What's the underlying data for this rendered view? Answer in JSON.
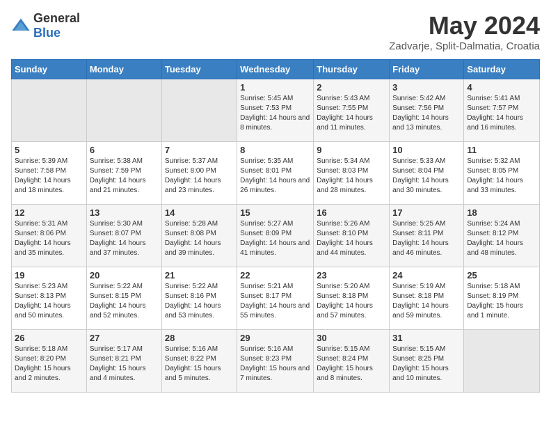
{
  "logo": {
    "text_general": "General",
    "text_blue": "Blue"
  },
  "header": {
    "month": "May 2024",
    "location": "Zadvarje, Split-Dalmatia, Croatia"
  },
  "days_of_week": [
    "Sunday",
    "Monday",
    "Tuesday",
    "Wednesday",
    "Thursday",
    "Friday",
    "Saturday"
  ],
  "weeks": [
    [
      {
        "day": "",
        "info": ""
      },
      {
        "day": "",
        "info": ""
      },
      {
        "day": "",
        "info": ""
      },
      {
        "day": "1",
        "info": "Sunrise: 5:45 AM\nSunset: 7:53 PM\nDaylight: 14 hours and 8 minutes."
      },
      {
        "day": "2",
        "info": "Sunrise: 5:43 AM\nSunset: 7:55 PM\nDaylight: 14 hours and 11 minutes."
      },
      {
        "day": "3",
        "info": "Sunrise: 5:42 AM\nSunset: 7:56 PM\nDaylight: 14 hours and 13 minutes."
      },
      {
        "day": "4",
        "info": "Sunrise: 5:41 AM\nSunset: 7:57 PM\nDaylight: 14 hours and 16 minutes."
      }
    ],
    [
      {
        "day": "5",
        "info": "Sunrise: 5:39 AM\nSunset: 7:58 PM\nDaylight: 14 hours and 18 minutes."
      },
      {
        "day": "6",
        "info": "Sunrise: 5:38 AM\nSunset: 7:59 PM\nDaylight: 14 hours and 21 minutes."
      },
      {
        "day": "7",
        "info": "Sunrise: 5:37 AM\nSunset: 8:00 PM\nDaylight: 14 hours and 23 minutes."
      },
      {
        "day": "8",
        "info": "Sunrise: 5:35 AM\nSunset: 8:01 PM\nDaylight: 14 hours and 26 minutes."
      },
      {
        "day": "9",
        "info": "Sunrise: 5:34 AM\nSunset: 8:03 PM\nDaylight: 14 hours and 28 minutes."
      },
      {
        "day": "10",
        "info": "Sunrise: 5:33 AM\nSunset: 8:04 PM\nDaylight: 14 hours and 30 minutes."
      },
      {
        "day": "11",
        "info": "Sunrise: 5:32 AM\nSunset: 8:05 PM\nDaylight: 14 hours and 33 minutes."
      }
    ],
    [
      {
        "day": "12",
        "info": "Sunrise: 5:31 AM\nSunset: 8:06 PM\nDaylight: 14 hours and 35 minutes."
      },
      {
        "day": "13",
        "info": "Sunrise: 5:30 AM\nSunset: 8:07 PM\nDaylight: 14 hours and 37 minutes."
      },
      {
        "day": "14",
        "info": "Sunrise: 5:28 AM\nSunset: 8:08 PM\nDaylight: 14 hours and 39 minutes."
      },
      {
        "day": "15",
        "info": "Sunrise: 5:27 AM\nSunset: 8:09 PM\nDaylight: 14 hours and 41 minutes."
      },
      {
        "day": "16",
        "info": "Sunrise: 5:26 AM\nSunset: 8:10 PM\nDaylight: 14 hours and 44 minutes."
      },
      {
        "day": "17",
        "info": "Sunrise: 5:25 AM\nSunset: 8:11 PM\nDaylight: 14 hours and 46 minutes."
      },
      {
        "day": "18",
        "info": "Sunrise: 5:24 AM\nSunset: 8:12 PM\nDaylight: 14 hours and 48 minutes."
      }
    ],
    [
      {
        "day": "19",
        "info": "Sunrise: 5:23 AM\nSunset: 8:13 PM\nDaylight: 14 hours and 50 minutes."
      },
      {
        "day": "20",
        "info": "Sunrise: 5:22 AM\nSunset: 8:15 PM\nDaylight: 14 hours and 52 minutes."
      },
      {
        "day": "21",
        "info": "Sunrise: 5:22 AM\nSunset: 8:16 PM\nDaylight: 14 hours and 53 minutes."
      },
      {
        "day": "22",
        "info": "Sunrise: 5:21 AM\nSunset: 8:17 PM\nDaylight: 14 hours and 55 minutes."
      },
      {
        "day": "23",
        "info": "Sunrise: 5:20 AM\nSunset: 8:18 PM\nDaylight: 14 hours and 57 minutes."
      },
      {
        "day": "24",
        "info": "Sunrise: 5:19 AM\nSunset: 8:18 PM\nDaylight: 14 hours and 59 minutes."
      },
      {
        "day": "25",
        "info": "Sunrise: 5:18 AM\nSunset: 8:19 PM\nDaylight: 15 hours and 1 minute."
      }
    ],
    [
      {
        "day": "26",
        "info": "Sunrise: 5:18 AM\nSunset: 8:20 PM\nDaylight: 15 hours and 2 minutes."
      },
      {
        "day": "27",
        "info": "Sunrise: 5:17 AM\nSunset: 8:21 PM\nDaylight: 15 hours and 4 minutes."
      },
      {
        "day": "28",
        "info": "Sunrise: 5:16 AM\nSunset: 8:22 PM\nDaylight: 15 hours and 5 minutes."
      },
      {
        "day": "29",
        "info": "Sunrise: 5:16 AM\nSunset: 8:23 PM\nDaylight: 15 hours and 7 minutes."
      },
      {
        "day": "30",
        "info": "Sunrise: 5:15 AM\nSunset: 8:24 PM\nDaylight: 15 hours and 8 minutes."
      },
      {
        "day": "31",
        "info": "Sunrise: 5:15 AM\nSunset: 8:25 PM\nDaylight: 15 hours and 10 minutes."
      },
      {
        "day": "",
        "info": ""
      }
    ]
  ]
}
